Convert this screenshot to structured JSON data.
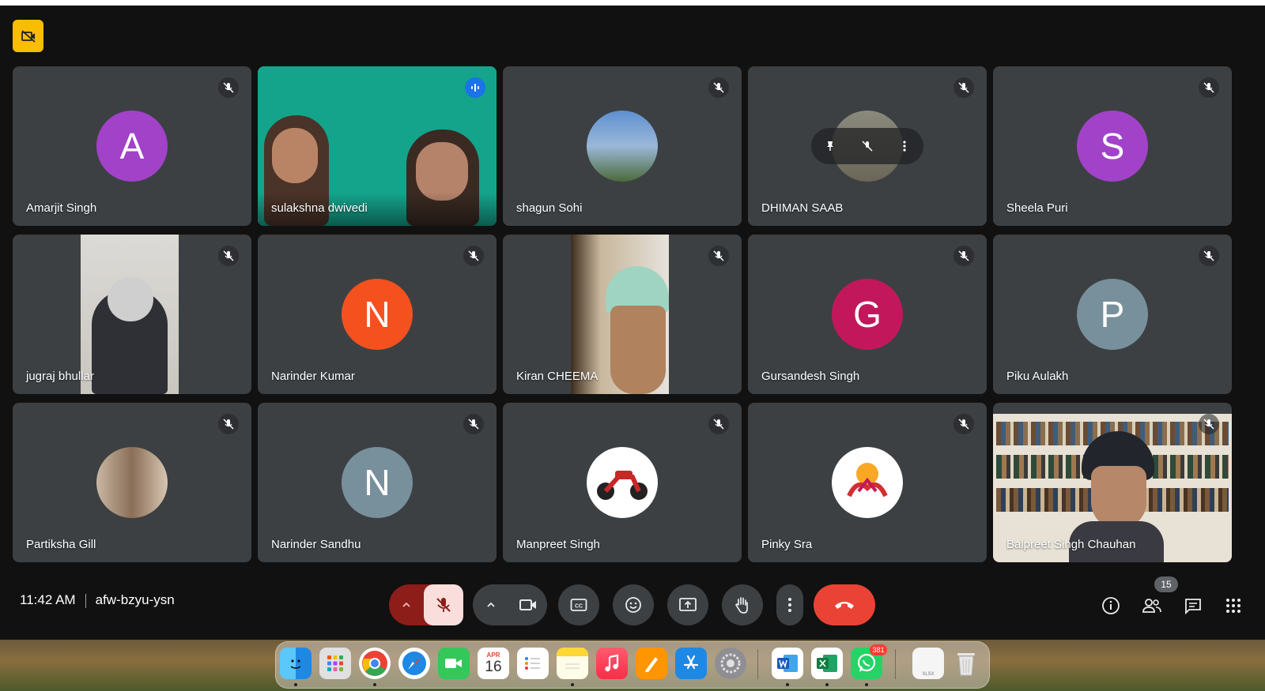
{
  "meeting": {
    "time": "11:42 AM",
    "code": "afw-bzyu-ysn",
    "participant_count": "15"
  },
  "tiles": [
    {
      "name": "Amarjit Singh",
      "initial": "A",
      "avatar_color": "#a142c8",
      "status": "muted"
    },
    {
      "name": "sulakshna dwivedi",
      "status": "speaking",
      "video": true
    },
    {
      "name": "shagun Sohi",
      "status": "muted",
      "photo": true
    },
    {
      "name": "DHIMAN SAAB",
      "status": "muted",
      "photo": true,
      "hover_controls": true
    },
    {
      "name": "Sheela Puri",
      "initial": "S",
      "avatar_color": "#a142c8",
      "status": "muted"
    },
    {
      "name": "jugraj bhullar",
      "status": "muted",
      "video": true
    },
    {
      "name": "Narinder Kumar",
      "initial": "N",
      "avatar_color": "#f4511e",
      "status": "muted"
    },
    {
      "name": "Kiran CHEEMA",
      "status": "muted",
      "video": true
    },
    {
      "name": "Gursandesh Singh",
      "initial": "G",
      "avatar_color": "#c2185b",
      "status": "muted"
    },
    {
      "name": "Piku Aulakh",
      "initial": "P",
      "avatar_color": "#78909c",
      "status": "muted"
    },
    {
      "name": "Partiksha Gill",
      "status": "muted",
      "photo": true
    },
    {
      "name": "Narinder Sandhu",
      "initial": "N",
      "avatar_color": "#78909c",
      "status": "muted"
    },
    {
      "name": "Manpreet Singh",
      "status": "muted",
      "photo": true
    },
    {
      "name": "Pinky Sra",
      "status": "muted",
      "photo": true
    },
    {
      "name": "Balpreet Singh Chauhan",
      "status": "muted",
      "video": true
    }
  ],
  "dock": {
    "calendar_month": "APR",
    "calendar_day": "16",
    "whatsapp_badge": "381",
    "file_label": "XLSX"
  },
  "colors": {
    "meet_bg": "#111111",
    "tile_bg": "#3c4043",
    "leave_red": "#ea4335",
    "mic_off_bg": "#f9dedc",
    "active_border": "#8ab4f8"
  }
}
